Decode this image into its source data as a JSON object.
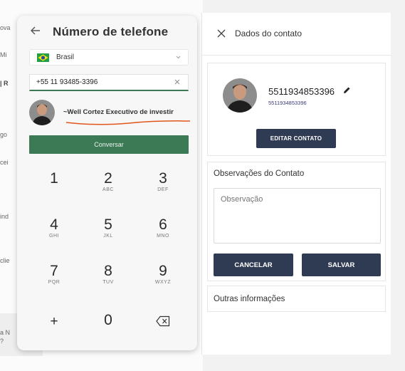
{
  "background": {
    "fragments": [
      "ova",
      "Mi",
      "| R",
      "go",
      "cei",
      "ind",
      "clie",
      "a N",
      "?"
    ]
  },
  "dialer": {
    "title": "Número de telefone",
    "country": "Brasil",
    "phone_value": "+55 11 93485-3396",
    "contact_name": "~Well Cortez Executivo de investir",
    "call_label": "Conversar",
    "keys": [
      {
        "digit": "1",
        "letters": ""
      },
      {
        "digit": "2",
        "letters": "ABC"
      },
      {
        "digit": "3",
        "letters": "DEF"
      },
      {
        "digit": "4",
        "letters": "GHI"
      },
      {
        "digit": "5",
        "letters": "JKL"
      },
      {
        "digit": "6",
        "letters": "MNO"
      },
      {
        "digit": "7",
        "letters": "PQR"
      },
      {
        "digit": "8",
        "letters": "TUV"
      },
      {
        "digit": "9",
        "letters": "WXYZ"
      },
      {
        "digit": "+",
        "letters": ""
      },
      {
        "digit": "0",
        "letters": ""
      }
    ],
    "icons": {
      "back": "arrow-left-icon",
      "flag": "brazil-flag-icon",
      "dropdown": "chevron-down-icon",
      "clear": "close-icon",
      "backspace": "backspace-icon"
    }
  },
  "details": {
    "title": "Dados do contato",
    "contact_name": "5511934853396",
    "contact_phone": "5511934853396",
    "edit_label": "EDITAR CONTATO",
    "notes_title": "Observações do Contato",
    "notes_placeholder": "Observação",
    "cancel_label": "CANCELAR",
    "save_label": "SALVAR",
    "other_title": "Outras informações",
    "icons": {
      "close": "close-icon",
      "edit": "pencil-icon"
    }
  },
  "colors": {
    "accent_green": "#3c7a56",
    "button_navy": "#2f3b52",
    "annotation_orange": "#e0561b"
  }
}
